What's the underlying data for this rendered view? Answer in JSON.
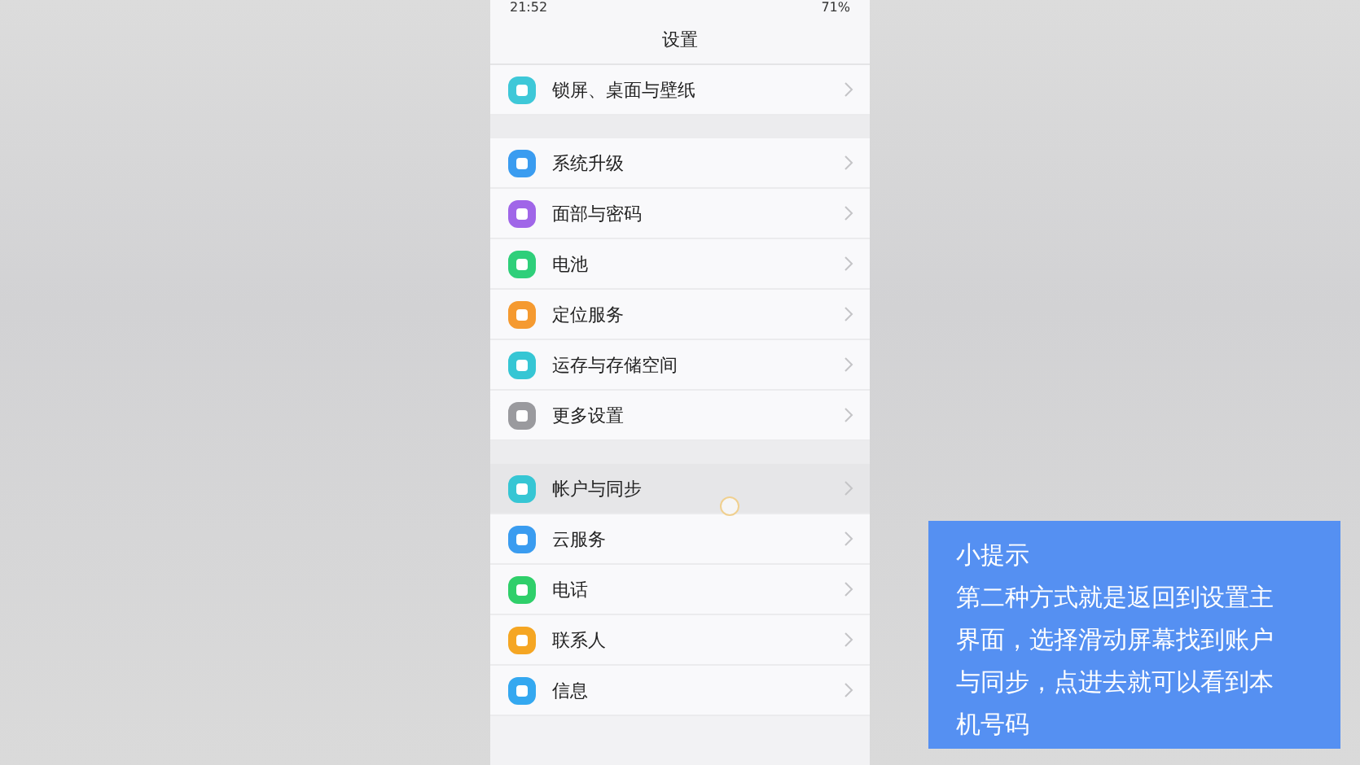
{
  "status_bar": {
    "time": "21:52",
    "battery": "71%"
  },
  "title": "设置",
  "sections": [
    {
      "items": [
        {
          "label": "锁屏、桌面与壁纸",
          "color": "#3ec8d8",
          "selected": false
        }
      ]
    },
    {
      "items": [
        {
          "label": "系统升级",
          "color": "#3a9cf0",
          "selected": false
        },
        {
          "label": "面部与密码",
          "color": "#a066e8",
          "selected": false
        },
        {
          "label": "电池",
          "color": "#2fcf7a",
          "selected": false
        },
        {
          "label": "定位服务",
          "color": "#f59a30",
          "selected": false
        },
        {
          "label": "运存与存储空间",
          "color": "#36c6d4",
          "selected": false
        },
        {
          "label": "更多设置",
          "color": "#9a9a9e",
          "selected": false
        }
      ]
    },
    {
      "items": [
        {
          "label": "帐户与同步",
          "color": "#36c6d4",
          "selected": true
        },
        {
          "label": "云服务",
          "color": "#3a9cf0",
          "selected": false
        },
        {
          "label": "电话",
          "color": "#2fcf6a",
          "selected": false
        },
        {
          "label": "联系人",
          "color": "#f5a623",
          "selected": false
        },
        {
          "label": "信息",
          "color": "#34a8f0",
          "selected": false
        }
      ]
    }
  ],
  "tip": {
    "title": "小提示",
    "text": "第二种方式就是返回到设置主界面，选择滑动屏幕找到账户与同步，点进去就可以看到本机号码"
  }
}
